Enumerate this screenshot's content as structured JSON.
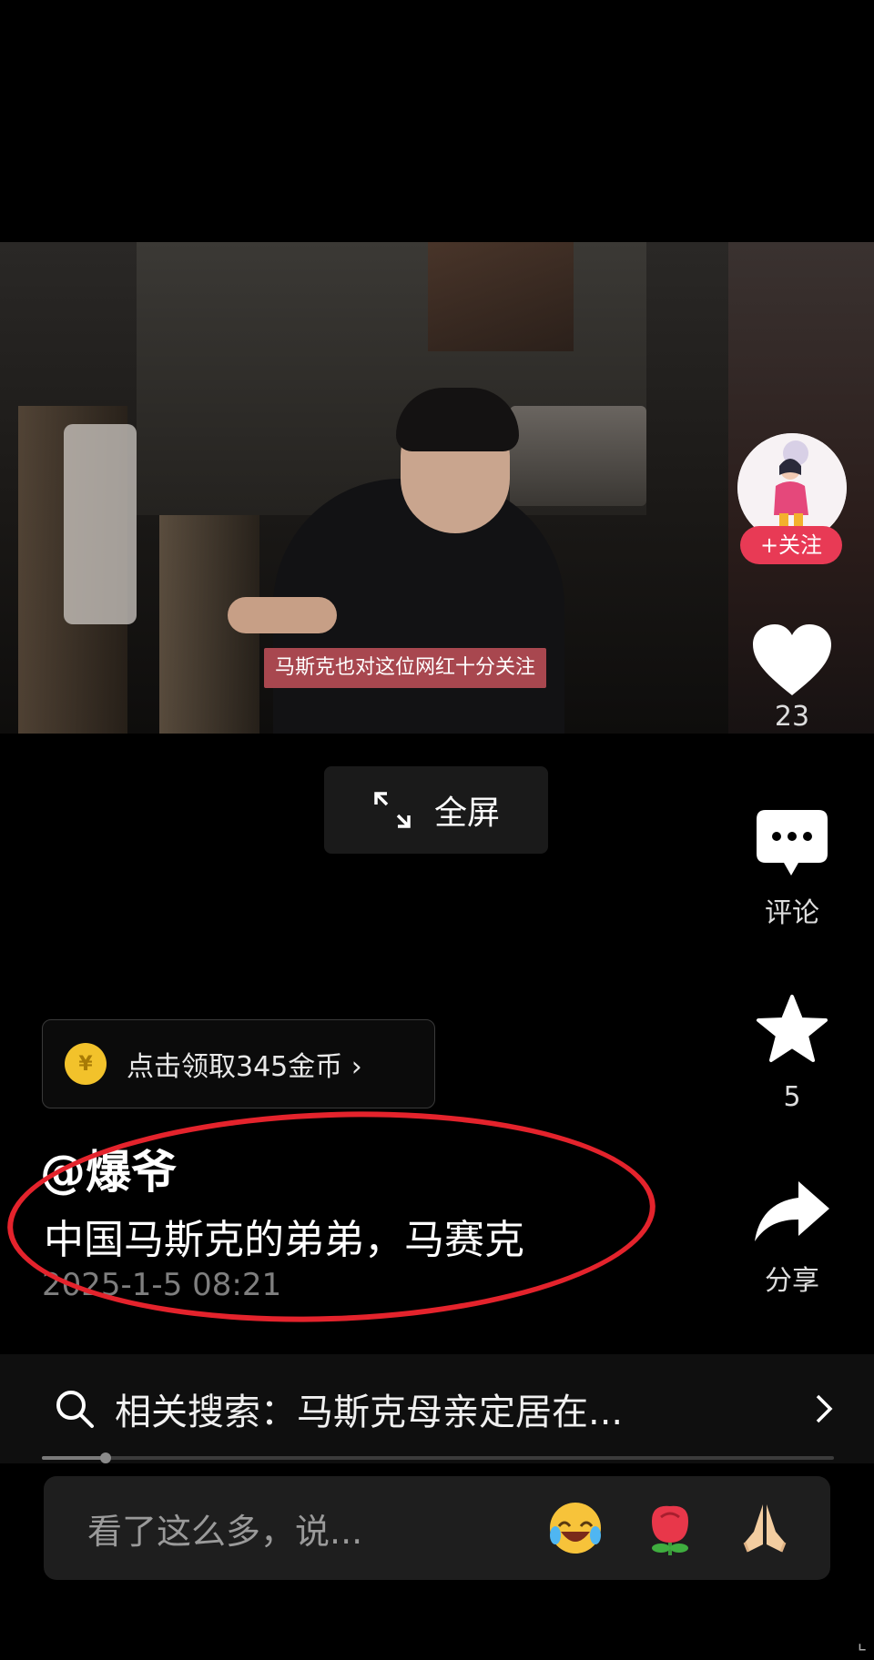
{
  "video": {
    "caption": "马斯克也对这位网红十分关注"
  },
  "fullscreen": {
    "label": "全屏"
  },
  "rail": {
    "follow_label": "+关注",
    "likes": "23",
    "comment_label": "评论",
    "favorites": "5",
    "share_label": "分享"
  },
  "coin_reward": {
    "label": "点击领取345金币 ›",
    "coin_glyph": "¥"
  },
  "post": {
    "username": "@爆爷",
    "description": "中国马斯克的弟弟，马赛克",
    "timestamp": "2025-1-5 08:21"
  },
  "related_search": {
    "label": "相关搜索：马斯克母亲定居在..."
  },
  "progress": {
    "fraction": 0.08
  },
  "comment": {
    "placeholder": "看了这么多，说...",
    "emojis": [
      "laughing-crying-emoji",
      "rose-emoji",
      "praying-hands-emoji"
    ]
  },
  "colors": {
    "follow": "#e83a55",
    "caption_bg": "#a8474f",
    "annotation_circle": "#e4232c",
    "coin": "#f2c22b"
  }
}
